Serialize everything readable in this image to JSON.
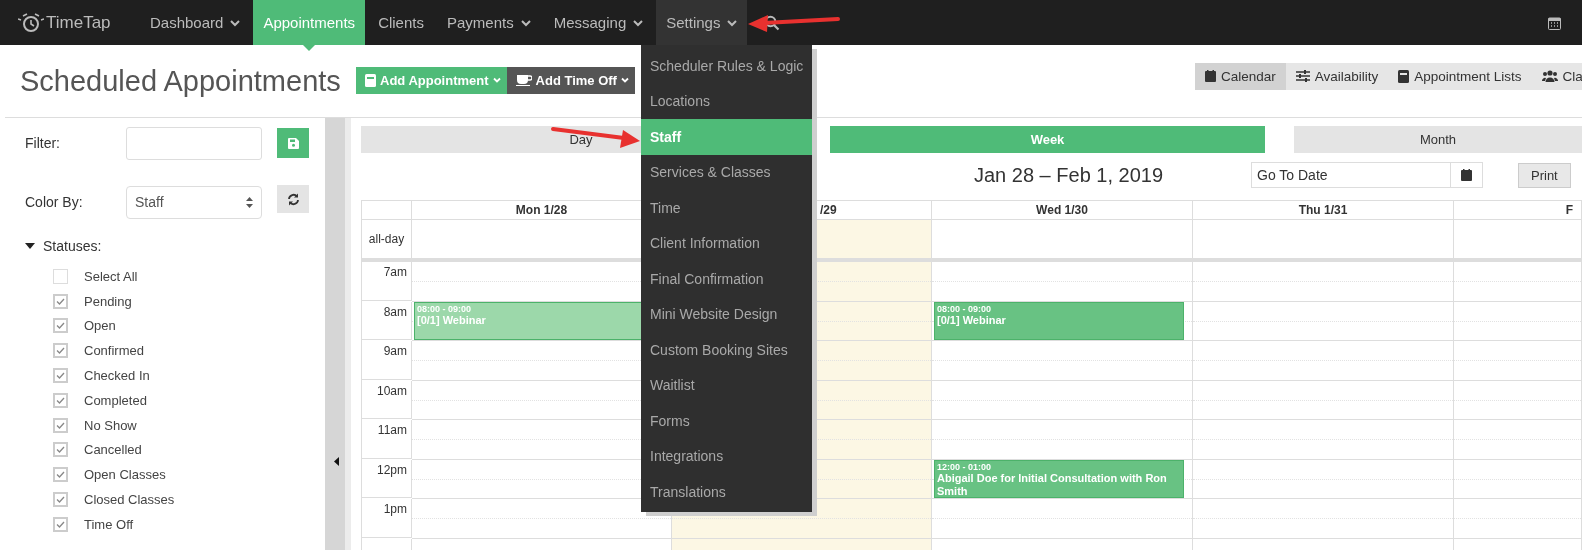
{
  "nav": {
    "logo": "TimeTap",
    "items": [
      {
        "label": "Dashboard",
        "dropdown": true,
        "selected": false,
        "open": false
      },
      {
        "label": "Appointments",
        "dropdown": false,
        "selected": true,
        "open": false
      },
      {
        "label": "Clients",
        "dropdown": false,
        "selected": false,
        "open": false
      },
      {
        "label": "Payments",
        "dropdown": true,
        "selected": false,
        "open": false
      },
      {
        "label": "Messaging",
        "dropdown": true,
        "selected": false,
        "open": false
      },
      {
        "label": "Settings",
        "dropdown": true,
        "selected": false,
        "open": true
      }
    ]
  },
  "settings_menu": {
    "items": [
      {
        "label": "Scheduler Rules & Logic",
        "selected": false
      },
      {
        "label": "Locations",
        "selected": false
      },
      {
        "label": "Staff",
        "selected": true
      },
      {
        "label": "Services & Classes",
        "selected": false
      },
      {
        "label": "Time",
        "selected": false
      },
      {
        "label": "Client Information",
        "selected": false
      },
      {
        "label": "Final Confirmation",
        "selected": false
      },
      {
        "label": "Mini Website Design",
        "selected": false
      },
      {
        "label": "Custom Booking Sites",
        "selected": false
      },
      {
        "label": "Waitlist",
        "selected": false
      },
      {
        "label": "Forms",
        "selected": false
      },
      {
        "label": "Integrations",
        "selected": false
      },
      {
        "label": "Translations",
        "selected": false
      }
    ]
  },
  "annotations": [
    {
      "kind": "arrow"
    },
    {
      "kind": "arrow"
    }
  ],
  "page_title": "Scheduled Appointments",
  "actions": [
    {
      "label": "Add Appointment",
      "kind": "primary"
    },
    {
      "label": "Add Time Off",
      "kind": "dark"
    }
  ],
  "view_tabs": [
    {
      "label": "Calendar",
      "selected": true
    },
    {
      "label": "Availability",
      "selected": false
    },
    {
      "label": "Appointment Lists",
      "selected": false
    },
    {
      "label": "Cla",
      "selected": false
    }
  ],
  "sidebar": {
    "filter": {
      "label": "Filter:"
    },
    "color_by": {
      "label": "Color By:",
      "value": "Staff"
    },
    "statuses": {
      "label": "Statuses:",
      "expanded": true,
      "items": [
        {
          "label": "Select All",
          "checked": false
        },
        {
          "label": "Pending",
          "checked": true
        },
        {
          "label": "Open",
          "checked": true
        },
        {
          "label": "Confirmed",
          "checked": true
        },
        {
          "label": "Checked In",
          "checked": true
        },
        {
          "label": "Completed",
          "checked": true
        },
        {
          "label": "No Show",
          "checked": true
        },
        {
          "label": "Cancelled",
          "checked": true
        },
        {
          "label": "Open Classes",
          "checked": true
        },
        {
          "label": "Closed Classes",
          "checked": true
        },
        {
          "label": "Time Off",
          "checked": true
        }
      ]
    }
  },
  "calendar": {
    "ranges": [
      {
        "label": "Day",
        "selected": false
      },
      {
        "label": "Week",
        "selected": true
      },
      {
        "label": "Month",
        "selected": false
      }
    ],
    "date_title": "Jan 28 – Feb 1, 2019",
    "goto": {
      "placeholder": "Go To Date"
    },
    "print": "Print",
    "columns": [
      {
        "label": "Mon 1/28",
        "today": false,
        "events": [
          {
            "time": "08:00 - 09:00",
            "title": "[0/1] Webinar",
            "color": "#9cd8aa"
          }
        ]
      },
      {
        "label": "/29",
        "today": true
      },
      {
        "label": "Wed 1/30",
        "today": false,
        "events": [
          {
            "time": "08:00 - 09:00",
            "title": "[0/1] Webinar",
            "color": "#68c283"
          },
          {
            "time": "12:00 - 01:00",
            "title": "Abigail Doe for Initial Consultation with Ron Smith",
            "color": "#68c283"
          }
        ]
      },
      {
        "label": "Thu 1/31",
        "today": false
      },
      {
        "label": "F",
        "today": false
      }
    ],
    "all_day": "all-day",
    "hours": [
      "7am",
      "8am",
      "9am",
      "10am",
      "11am",
      "12pm",
      "1pm"
    ]
  }
}
